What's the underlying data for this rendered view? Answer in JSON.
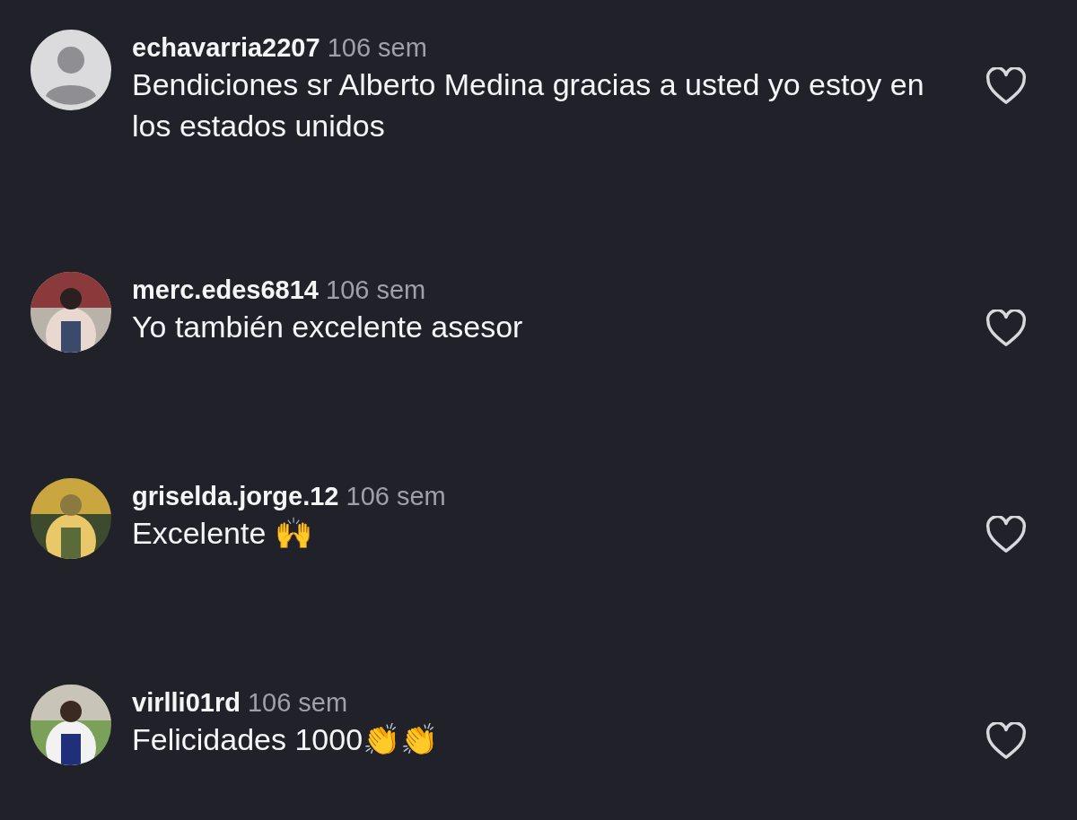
{
  "comments": [
    {
      "avatar": {
        "kind": "default"
      },
      "username": "echavarria2207",
      "time": "106 sem",
      "text": "Bendiciones sr Alberto Medina gracias a usted yo estoy en los estados unidos",
      "liked": false
    },
    {
      "username": "merc.edes6814",
      "time": "106 sem",
      "text": "Yo también excelente asesor",
      "liked": false
    },
    {
      "username": "griselda.jorge.12",
      "time": "106 sem",
      "text": "Excelente 🙌",
      "liked": false
    },
    {
      "username": "virlli01rd",
      "time": "106 sem",
      "text": "Felicidades 1000👏👏",
      "liked": false
    }
  ]
}
